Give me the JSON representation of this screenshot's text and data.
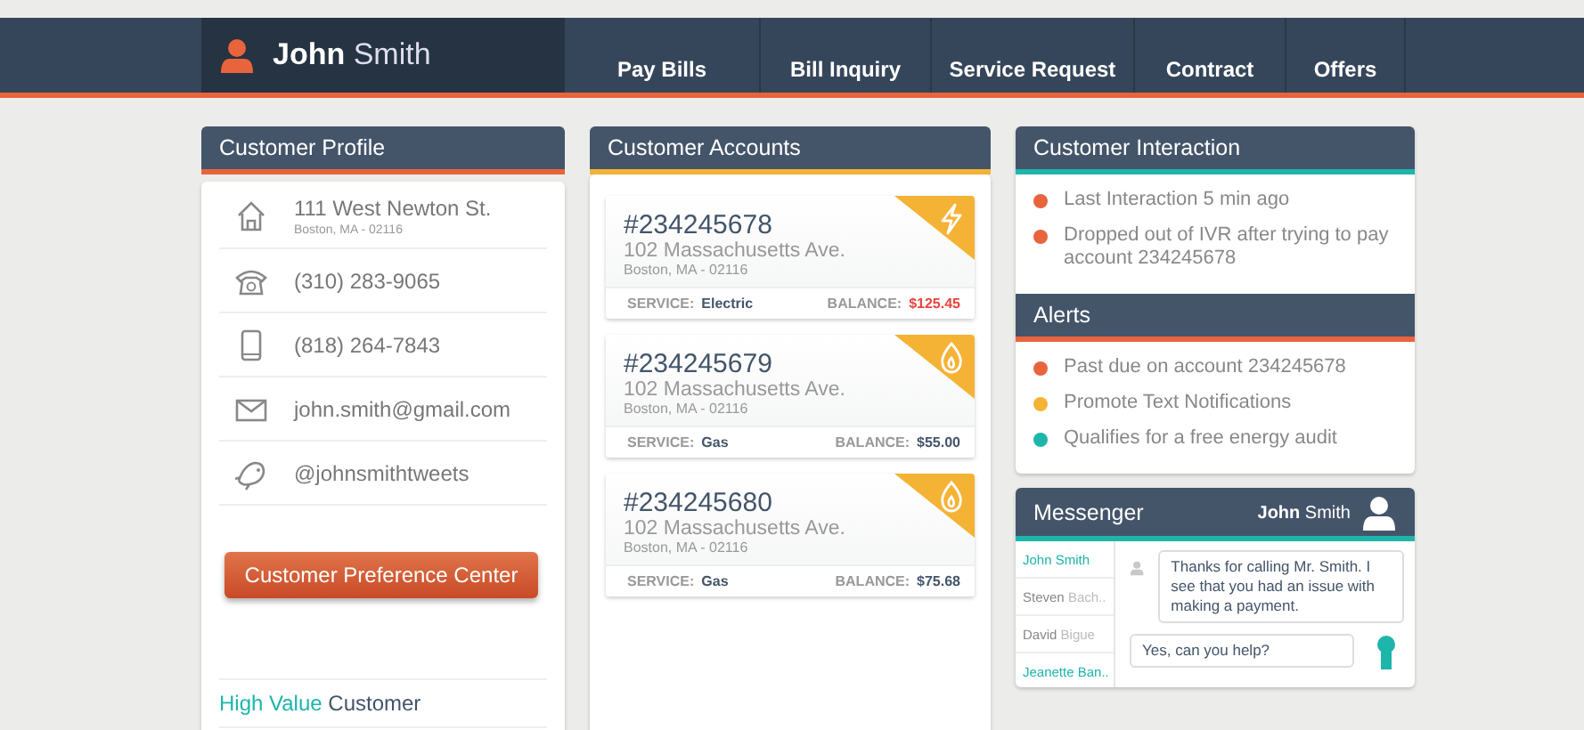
{
  "header": {
    "user": {
      "first": "John",
      "last": "Smith"
    },
    "nav": [
      {
        "label": "Pay Bills",
        "selected": false
      },
      {
        "label": "Bill Inquiry",
        "selected": false
      },
      {
        "label": "Service Request",
        "selected": false
      },
      {
        "label": "Contract",
        "selected": false
      },
      {
        "label": "Offers",
        "selected": false
      }
    ]
  },
  "profile": {
    "title": "Customer Profile",
    "contacts": [
      {
        "kind": "address",
        "text": "111 West Newton St.",
        "sub": "Boston, MA - 02116"
      },
      {
        "kind": "phone",
        "text": "(310) 283-9065"
      },
      {
        "kind": "mobile",
        "text": "(818) 264-7843"
      },
      {
        "kind": "email",
        "text": "john.smith@gmail.com"
      },
      {
        "kind": "twitter",
        "text": "@johnsmithtweets"
      }
    ],
    "button": "Customer Preference Center",
    "tier": {
      "level": "High Value",
      "label": "Customer"
    }
  },
  "accounts": {
    "title": "Customer Accounts",
    "items": [
      {
        "kind": "electric",
        "number": "#234245678",
        "street": "102 Massachusetts Ave.",
        "city": "Boston, MA - 02116",
        "service_label": "SERVICE:",
        "service": "Electric",
        "balance_label": "BALANCE:",
        "balance": "$125.45",
        "overdue": true
      },
      {
        "kind": "gas",
        "number": "#234245679",
        "street": "102 Massachusetts Ave.",
        "city": "Boston, MA - 02116",
        "service_label": "SERVICE:",
        "service": "Gas",
        "balance_label": "BALANCE:",
        "balance": "$55.00",
        "overdue": false
      },
      {
        "kind": "gas",
        "number": "#234245680",
        "street": "102 Massachusetts Ave.",
        "city": "Boston, MA - 02116",
        "service_label": "SERVICE:",
        "service": "Gas",
        "balance_label": "BALANCE:",
        "balance": "$75.68",
        "overdue": false
      }
    ]
  },
  "interaction": {
    "title": "Customer Interaction",
    "items": [
      {
        "text": "Last Interaction 5 min ago",
        "color": "#e8643c"
      },
      {
        "text": "Dropped out of IVR after trying to pay account 234245678",
        "color": "#e8643c"
      }
    ]
  },
  "alerts": {
    "title": "Alerts",
    "items": [
      {
        "text": "Past due on account 234245678",
        "color": "#e8643c"
      },
      {
        "text": "Promote Text Notifications",
        "color": "#f5b335"
      },
      {
        "text": "Qualifies for a free energy audit",
        "color": "#1eb5ab"
      }
    ]
  },
  "messenger": {
    "title": "Messenger",
    "user": {
      "first": "John",
      "last": "Smith"
    },
    "contacts": [
      {
        "first": "John",
        "last": "Smith",
        "online": true
      },
      {
        "first": "Steven",
        "last": "Bach..",
        "online": false
      },
      {
        "first": "David",
        "last": "Bigue",
        "online": false
      },
      {
        "first": "Jeanette",
        "last": "Ban..",
        "online": true
      }
    ],
    "messages": [
      {
        "kind": "agent",
        "text": "Thanks for calling Mr. Smith. I see that you had an issue with making a payment."
      },
      {
        "kind": "customer",
        "text": "Yes, can you help?"
      }
    ]
  }
}
